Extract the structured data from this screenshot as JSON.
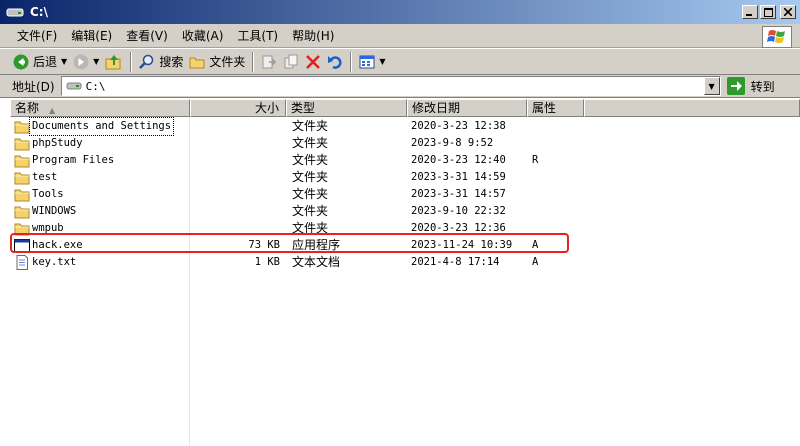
{
  "window": {
    "title": "C:\\"
  },
  "menu": {
    "items": [
      "文件(F)",
      "编辑(E)",
      "查看(V)",
      "收藏(A)",
      "工具(T)",
      "帮助(H)"
    ]
  },
  "toolbar": {
    "back_label": "后退",
    "search_label": "搜索",
    "folders_label": "文件夹"
  },
  "address": {
    "label": "地址(D)",
    "value": "C:\\",
    "go_label": "转到"
  },
  "columns": {
    "name": "名称",
    "size": "大小",
    "type": "类型",
    "modified": "修改日期",
    "attributes": "属性"
  },
  "files": [
    {
      "name": "Documents and Settings",
      "size": "",
      "type": "文件夹",
      "modified": "2020-3-23 12:38",
      "attr": "",
      "icon": "folder-icon"
    },
    {
      "name": "phpStudy",
      "size": "",
      "type": "文件夹",
      "modified": "2023-9-8 9:52",
      "attr": "",
      "icon": "folder-icon"
    },
    {
      "name": "Program Files",
      "size": "",
      "type": "文件夹",
      "modified": "2020-3-23 12:40",
      "attr": "R",
      "icon": "folder-icon"
    },
    {
      "name": "test",
      "size": "",
      "type": "文件夹",
      "modified": "2023-3-31 14:59",
      "attr": "",
      "icon": "folder-icon"
    },
    {
      "name": "Tools",
      "size": "",
      "type": "文件夹",
      "modified": "2023-3-31 14:57",
      "attr": "",
      "icon": "folder-icon"
    },
    {
      "name": "WINDOWS",
      "size": "",
      "type": "文件夹",
      "modified": "2023-9-10 22:32",
      "attr": "",
      "icon": "folder-icon"
    },
    {
      "name": "wmpub",
      "size": "",
      "type": "文件夹",
      "modified": "2020-3-23 12:36",
      "attr": "",
      "icon": "folder-icon"
    },
    {
      "name": "hack.exe",
      "size": "73 KB",
      "type": "应用程序",
      "modified": "2023-11-24 10:39",
      "attr": "A",
      "icon": "exe-icon"
    },
    {
      "name": "key.txt",
      "size": "1 KB",
      "type": "文本文档",
      "modified": "2021-4-8 17:14",
      "attr": "A",
      "icon": "text-file-icon"
    }
  ],
  "colors": {
    "title_start": "#0a246a",
    "title_end": "#a6caf0",
    "chrome": "#d4d0c8",
    "highlight": "#e8231f",
    "folder": "#f5d26b"
  }
}
